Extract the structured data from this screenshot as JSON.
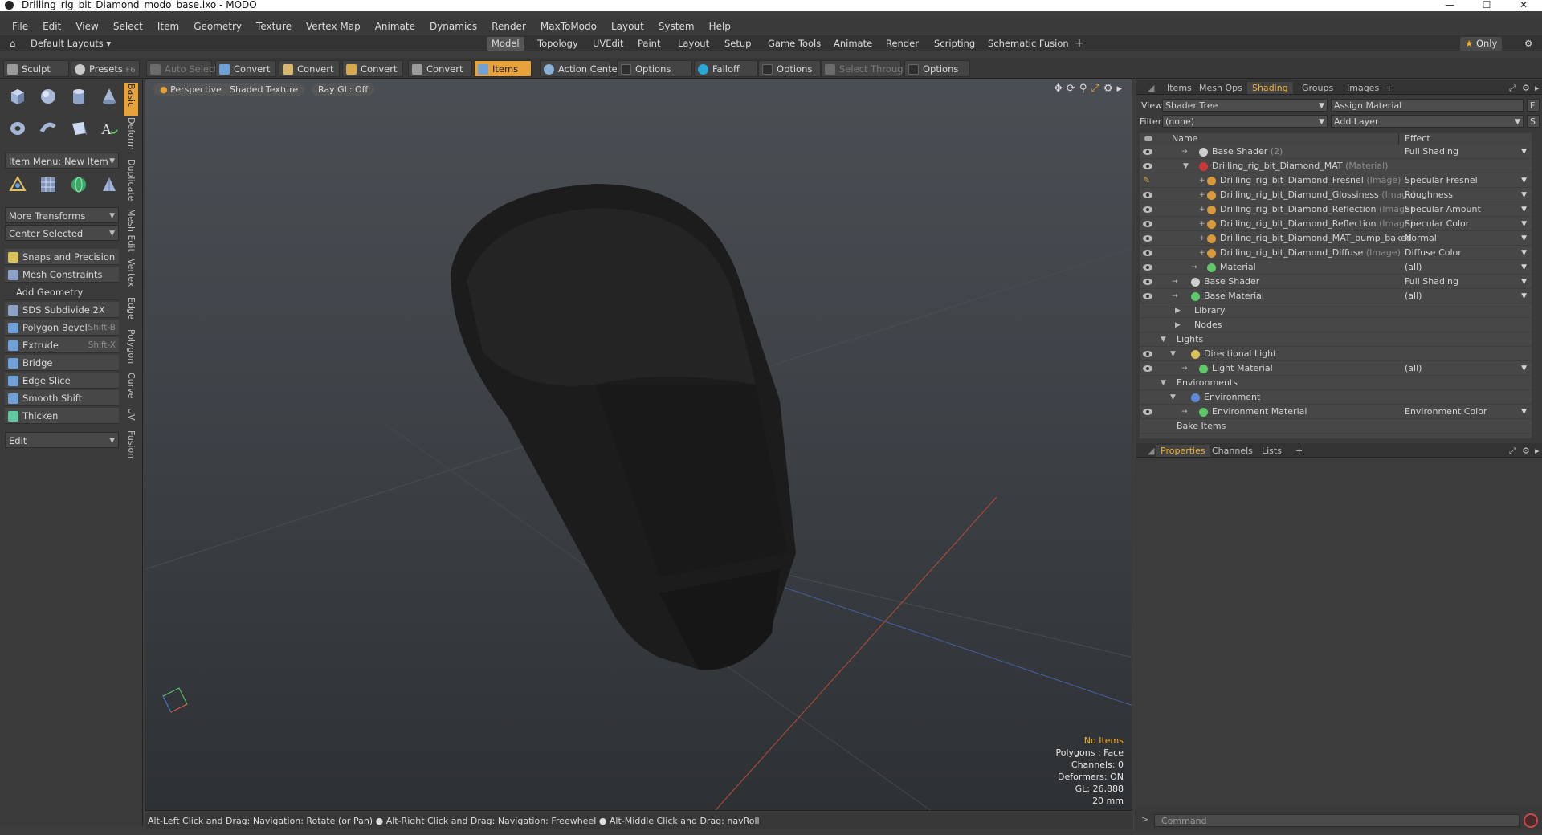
{
  "window": {
    "title": "Drilling_rig_bit_Diamond_modo_base.lxo - MODO",
    "min": "—",
    "max": "☐",
    "close": "✕"
  },
  "menu": [
    "File",
    "Edit",
    "View",
    "Select",
    "Item",
    "Geometry",
    "Texture",
    "Vertex Map",
    "Animate",
    "Dynamics",
    "Render",
    "MaxToModo",
    "Layout",
    "System",
    "Help"
  ],
  "layoutbar": {
    "default_layouts": "Default Layouts",
    "tabs": [
      "Model",
      "Topology",
      "UVEdit",
      "Paint",
      "Layout",
      "Setup",
      "Game Tools",
      "Animate",
      "Render",
      "Scripting",
      "Schematic Fusion"
    ],
    "add": "+",
    "only": "Only"
  },
  "toolbar": {
    "sculpt": "Sculpt",
    "presets": "Presets",
    "presets_key": "F6",
    "auto_select": "Auto Select",
    "convert1": "Convert",
    "convert2": "Convert",
    "convert3": "Convert",
    "convert4": "Convert",
    "items": "Items",
    "action_center": "Action Center",
    "options1": "Options",
    "falloff": "Falloff",
    "options2": "Options",
    "select_through": "Select Through",
    "options3": "Options"
  },
  "left": {
    "vtabs": [
      "Basic",
      "Deform",
      "Duplicate",
      "Mesh Edit",
      "Vertex",
      "Edge",
      "Polygon",
      "Curve",
      "UV",
      "Fusion"
    ],
    "item_menu": "Item Menu: New Item",
    "more_transforms": "More Transforms",
    "center_selected": "Center Selected",
    "snaps": "Snaps and Precision",
    "mesh_constraints": "Mesh Constraints",
    "add_geometry": "Add Geometry",
    "sds": "SDS Subdivide 2X",
    "poly_bevel": "Polygon Bevel",
    "poly_bevel_key": "Shift-B",
    "extrude": "Extrude",
    "extrude_key": "Shift-X",
    "bridge": "Bridge",
    "edge_slice": "Edge Slice",
    "smooth_shift": "Smooth Shift",
    "thicken": "Thicken",
    "edit": "Edit"
  },
  "viewport": {
    "perspective": "Perspective",
    "shaded": "Shaded Texture",
    "raygl": "Ray GL: Off",
    "info": {
      "no_items": "No Items",
      "polygons": "Polygons : Face",
      "channels": "Channels: 0",
      "deformers": "Deformers: ON",
      "gl": "GL: 26,888",
      "scale": "20 mm"
    }
  },
  "status": "Alt-Left Click and Drag: Navigation: Rotate (or Pan) ● Alt-Right Click and Drag: Navigation: Freewheel ● Alt-Middle Click and Drag: navRoll",
  "right": {
    "tabs": [
      "Items",
      "Mesh Ops",
      "Shading",
      "Groups",
      "Images"
    ],
    "add": "+",
    "view_label": "View",
    "view_value": "Shader Tree",
    "assign_material": "Assign Material",
    "f_btn": "F",
    "filter_label": "Filter",
    "filter_value": "(none)",
    "add_layer": "Add Layer",
    "s_btn": "S",
    "col_name": "Name",
    "col_effect": "Effect",
    "rows": [
      {
        "name": "Base Shader",
        "suffix": "(2)",
        "effect": "Full Shading"
      },
      {
        "name": "Drilling_rig_bit_Diamond_MAT",
        "suffix": "(Material)",
        "effect": ""
      },
      {
        "name": "Drilling_rig_bit_Diamond_Fresnel",
        "suffix": "(Image)",
        "effect": "Specular Fresnel"
      },
      {
        "name": "Drilling_rig_bit_Diamond_Glossiness",
        "suffix": "(Image)",
        "effect": "Roughness"
      },
      {
        "name": "Drilling_rig_bit_Diamond_Reflection",
        "suffix": "(Image)",
        "effect": "Specular Amount"
      },
      {
        "name": "Drilling_rig_bit_Diamond_Reflection",
        "suffix": "(Image)",
        "effect": "Specular Color"
      },
      {
        "name": "Drilling_rig_bit_Diamond_MAT_bump_baked",
        "suffix": "",
        "effect": "Normal"
      },
      {
        "name": "Drilling_rig_bit_Diamond_Diffuse",
        "suffix": "(Image)",
        "effect": "Diffuse Color"
      },
      {
        "name": "Material",
        "suffix": "",
        "effect": "(all)"
      },
      {
        "name": "Base Shader",
        "suffix": "",
        "effect": "Full Shading"
      },
      {
        "name": "Base Material",
        "suffix": "",
        "effect": "(all)"
      },
      {
        "name": "Library",
        "suffix": "",
        "effect": ""
      },
      {
        "name": "Nodes",
        "suffix": "",
        "effect": ""
      },
      {
        "name": "Lights",
        "suffix": "",
        "effect": ""
      },
      {
        "name": "Directional Light",
        "suffix": "",
        "effect": ""
      },
      {
        "name": "Light Material",
        "suffix": "",
        "effect": "(all)"
      },
      {
        "name": "Environments",
        "suffix": "",
        "effect": ""
      },
      {
        "name": "Environment",
        "suffix": "",
        "effect": ""
      },
      {
        "name": "Environment Material",
        "suffix": "",
        "effect": "Environment Color"
      },
      {
        "name": "Bake Items",
        "suffix": "",
        "effect": ""
      }
    ],
    "bottom_tabs": [
      "Properties",
      "Channels",
      "Lists"
    ],
    "bottom_add": "+",
    "command_placeholder": "Command"
  },
  "colors": {
    "accent": "#e8a23a",
    "tab_active": "#f0b030"
  }
}
